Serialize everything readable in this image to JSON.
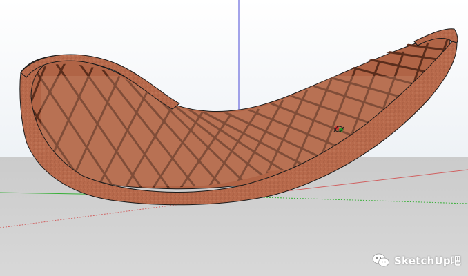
{
  "viewport": {
    "sky_color": "#f2f5f8",
    "ground_color": "#cfcfcf",
    "axis_colors": {
      "blue": "#4a4ad6",
      "red": "#d06060",
      "green": "#37b037"
    }
  },
  "model": {
    "name": "saddle-shell-lattice",
    "material_color": "#b86a4c",
    "material_dark": "#7a3f2a",
    "edge_color": "#1a1a1a"
  },
  "gizmo": {
    "name": "orbit-cursor-icon"
  },
  "watermark": {
    "icon": "wechat-icon",
    "text": "SketchUp吧"
  }
}
